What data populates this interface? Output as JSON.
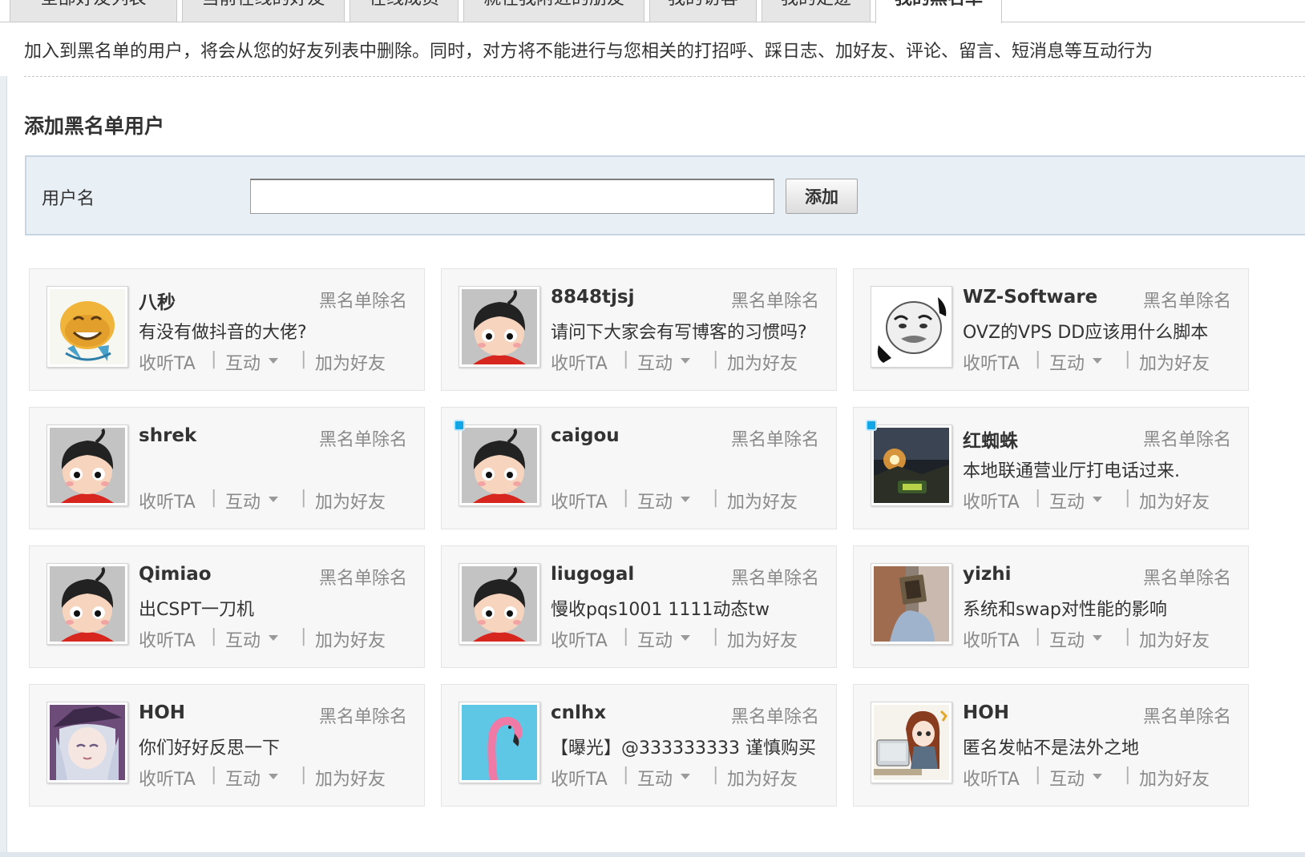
{
  "tabs": [
    {
      "label": "全部好友列表",
      "active": false
    },
    {
      "label": "当前在线的好友",
      "active": false
    },
    {
      "label": "在线成员",
      "active": false
    },
    {
      "label": "就在我附近的朋友",
      "active": false
    },
    {
      "label": "我的访客",
      "active": false
    },
    {
      "label": "我的足迹",
      "active": false
    },
    {
      "label": "我的黑名单",
      "active": true
    }
  ],
  "notice": "加入到黑名单的用户，将会从您的好友列表中删除。同时，对方将不能进行与您相关的打招呼、踩日志、加好友、评论、留言、短消息等互动行为",
  "add_section": {
    "title": "添加黑名单用户",
    "username_label": "用户名",
    "input_value": "",
    "input_placeholder": "",
    "add_button": "添加"
  },
  "action_labels": {
    "remove": "黑名单除名",
    "follow": "收听TA",
    "interact": "互动",
    "add_friend": "加为好友",
    "separator": "|"
  },
  "users": [
    {
      "name": "八秒",
      "status": "有没有做抖音的大佬?",
      "online": false,
      "avatar": "smiley-face-avatar"
    },
    {
      "name": "8848tjsj",
      "status": "请问下大家会有写博客的习惯吗?",
      "online": false,
      "avatar": "default-cartoon-avatar"
    },
    {
      "name": "WZ-Software",
      "status": "OVZ的VPS DD应该用什么脚本",
      "online": false,
      "avatar": "meme-face-avatar"
    },
    {
      "name": "shrek",
      "status": "",
      "online": false,
      "avatar": "default-cartoon-avatar"
    },
    {
      "name": "caigou",
      "status": "",
      "online": true,
      "avatar": "default-cartoon-avatar"
    },
    {
      "name": "红蜘蛛",
      "status": "本地联通营业厅打电话过来.",
      "online": true,
      "avatar": "game-scene-avatar"
    },
    {
      "name": "Qimiao",
      "status": "出CSPT一刀机",
      "online": false,
      "avatar": "default-cartoon-avatar"
    },
    {
      "name": "liugogal",
      "status": "慢收pqs1001 1111动态tw",
      "online": false,
      "avatar": "default-cartoon-avatar"
    },
    {
      "name": "yizhi",
      "status": "系统和swap对性能的影响",
      "online": false,
      "avatar": "photo-avatar"
    },
    {
      "name": "HOH",
      "status": "你们好好反思一下",
      "online": false,
      "avatar": "anime-girl-avatar"
    },
    {
      "name": "cnlhx",
      "status": "【曝光】@333333333 谨慎购买",
      "online": false,
      "avatar": "flamingo-avatar"
    },
    {
      "name": "HOH",
      "status": "匿名发帖不是法外之地",
      "online": false,
      "avatar": "anime-computer-avatar"
    }
  ],
  "colors": {
    "panel_bg": "#e8eff5",
    "online_dot": "#12a6e6",
    "muted_text": "#8a8a8a"
  }
}
